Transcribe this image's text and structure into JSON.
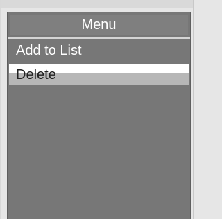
{
  "menu": {
    "title": "Menu",
    "items": [
      {
        "label": "Add to List",
        "selected": false
      },
      {
        "label": "Delete",
        "selected": true
      }
    ]
  },
  "colors": {
    "panel": "#777777",
    "title_bar": "#7f7f7f",
    "text": "#ffffff",
    "selected_item": "#ffffff"
  }
}
